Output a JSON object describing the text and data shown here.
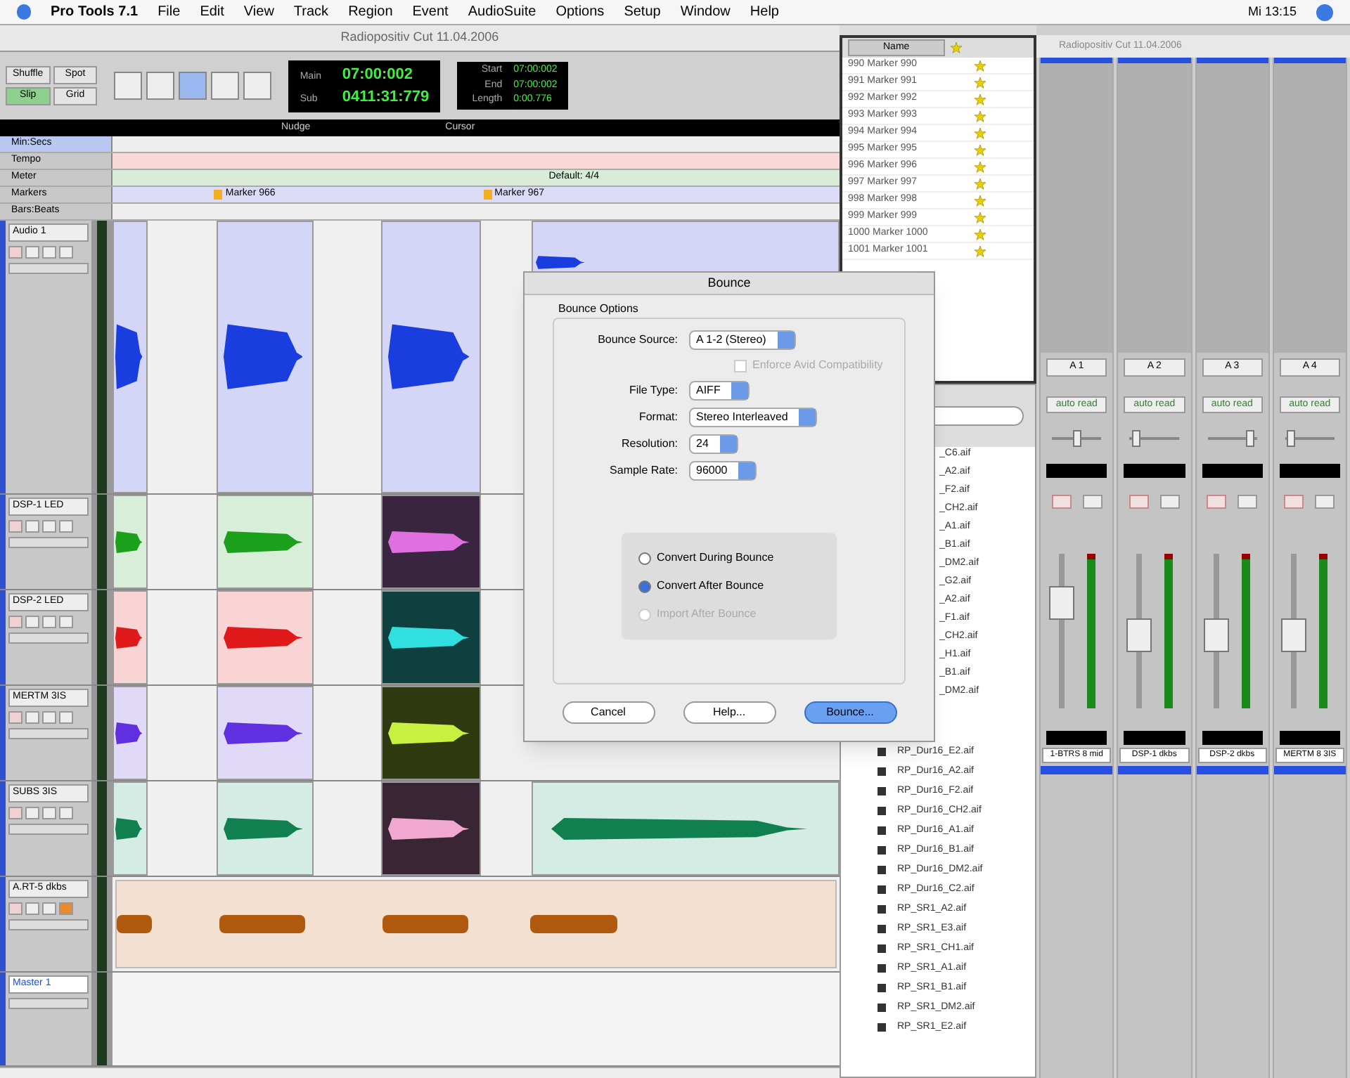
{
  "menu_bar": {
    "app": "Pro Tools 7.1",
    "items": [
      "File",
      "Edit",
      "View",
      "Track",
      "Region",
      "Event",
      "AudioSuite",
      "Options",
      "Setup",
      "Window",
      "Help"
    ],
    "clock": "Mi 13:15"
  },
  "edit_window": {
    "title": "Radiopositiv Cut 11.04.2006",
    "modes": [
      {
        "label": "Shuffle",
        "selected": false
      },
      {
        "label": "Spot",
        "selected": false
      },
      {
        "label": "Slip",
        "selected": true
      },
      {
        "label": "Grid",
        "selected": false
      }
    ],
    "counters": [
      {
        "label": "Main",
        "value": "07:00:002"
      },
      {
        "label": "Sub",
        "value": "0411:31:779"
      }
    ],
    "selection": [
      {
        "label": "Start",
        "value": "07:00:002"
      },
      {
        "label": "End",
        "value": "07:00:002"
      },
      {
        "label": "Length",
        "value": "0:00.776"
      }
    ],
    "strip_labels": [
      "Nudge",
      "Cursor"
    ],
    "rulers": [
      {
        "label": "Min:Secs",
        "kind": "plain"
      },
      {
        "label": "Tempo",
        "kind": "tempo"
      },
      {
        "label": "Meter",
        "kind": "meter",
        "text": "Default: 4/4"
      },
      {
        "label": "Markers",
        "kind": "markers",
        "markers": [
          "Marker 966",
          "Marker 967"
        ]
      },
      {
        "label": "Bars:Beats",
        "kind": "plain"
      }
    ],
    "tracks": [
      {
        "name": "Audio 1",
        "kind": "audio",
        "regions": [
          {
            "color": "#d4d6f8",
            "waveform": {
              "color": "#1a3de0"
            }
          },
          {
            "color": "#d4d6f8",
            "waveform": {
              "color": "#1a3de0"
            }
          },
          {
            "color": "#d4d6f8",
            "waveform": {
              "color": "#1a3de0"
            }
          },
          {
            "color": "#d4d6f8",
            "waveform": {
              "color": "#1a3de0"
            }
          }
        ]
      },
      {
        "name": "DSP-1 LED",
        "kind": "audio",
        "regions": [
          {
            "color": "#d8eed8",
            "waveform": {
              "color": "#1aa01a"
            }
          },
          {
            "color": "#d8eed8",
            "waveform": {
              "color": "#1aa01a"
            }
          },
          {
            "color": "#3a2540",
            "waveform": {
              "color": "#e070e0"
            }
          }
        ]
      },
      {
        "name": "DSP-2 LED",
        "kind": "audio",
        "regions": [
          {
            "color": "#f8d4d4",
            "waveform": {
              "color": "#e01a1a"
            }
          },
          {
            "color": "#f8d4d4",
            "waveform": {
              "color": "#e01a1a"
            }
          },
          {
            "color": "#0f4040",
            "waveform": {
              "color": "#30e0e0"
            }
          }
        ]
      },
      {
        "name": "MERTM 3IS",
        "kind": "audio",
        "regions": [
          {
            "color": "#e0daf8",
            "waveform": {
              "color": "#6030e0"
            }
          },
          {
            "color": "#e0daf8",
            "waveform": {
              "color": "#6030e0"
            }
          },
          {
            "color": "#303a10",
            "waveform": {
              "color": "#c8f040"
            }
          }
        ]
      },
      {
        "name": "SUBS 3IS",
        "kind": "audio",
        "regions": [
          {
            "color": "#d4ece4",
            "waveform": {
              "color": "#108050"
            }
          },
          {
            "color": "#d4ece4",
            "waveform": {
              "color": "#108050"
            }
          },
          {
            "color": "#3a2535",
            "waveform": {
              "color": "#f0a8d0"
            }
          },
          {
            "color": "#d4ece4",
            "waveform": {
              "color": "#108050"
            }
          }
        ]
      },
      {
        "name": "A.RT-5 dkbs",
        "kind": "lane",
        "regions": [
          {
            "color": "#f4e0d0",
            "waveform": {
              "color": "#b05a10"
            }
          }
        ]
      },
      {
        "name": "Master 1",
        "kind": "master"
      }
    ]
  },
  "marker_list": {
    "header": "Name",
    "rows": [
      "990 Marker 990",
      "991 Marker 991",
      "992 Marker 992",
      "993 Marker 993",
      "994 Marker 994",
      "995 Marker 995",
      "996 Marker 996",
      "997 Marker 997",
      "998 Marker 998",
      "999 Marker 999",
      "1000 Marker 1000",
      "1001 Marker 1001"
    ]
  },
  "region_list": {
    "hidden_rows": [
      "_C6.aif",
      "_A2.aif",
      "_F2.aif",
      "_CH2.aif",
      "_A1.aif",
      "_B1.aif",
      "_DM2.aif",
      "_G2.aif",
      "_A2.aif",
      "_F1.aif",
      "_CH2.aif",
      "_H1.aif",
      "_B1.aif",
      "_DM2.aif"
    ],
    "rows": [
      "RP_Dur16_E2.aif",
      "RP_Dur16_A2.aif",
      "RP_Dur16_F2.aif",
      "RP_Dur16_CH2.aif",
      "RP_Dur16_A1.aif",
      "RP_Dur16_B1.aif",
      "RP_Dur16_DM2.aif",
      "RP_Dur16_C2.aif",
      "RP_SR1_A2.aif",
      "RP_SR1_E3.aif",
      "RP_SR1_CH1.aif",
      "RP_SR1_A1.aif",
      "RP_SR1_B1.aif",
      "RP_SR1_DM2.aif",
      "RP_SR1_E2.aif"
    ]
  },
  "mixer": {
    "title": "Radiopositiv Cut 11.04.2006",
    "strips": [
      {
        "io": "A 1",
        "auto": "auto read",
        "pan": {
          "level": 0.5
        },
        "level": 0.72,
        "name": "1-BTRS 8 mid"
      },
      {
        "io": "A 2",
        "auto": "auto read",
        "pan": {
          "level": 0.05
        },
        "level": 0.45,
        "name": "DSP-1 dkbs"
      },
      {
        "io": "A 3",
        "auto": "auto read",
        "pan": {
          "level": 0.95
        },
        "level": 0.45,
        "name": "DSP-2 dkbs"
      },
      {
        "io": "A 4",
        "auto": "auto read",
        "pan": {
          "level": 0.05
        },
        "level": 0.45,
        "name": "MERTM 8 3IS"
      }
    ]
  },
  "dialog": {
    "title": "Bounce",
    "group": "Bounce Options",
    "fields": [
      {
        "label": "Bounce Source:",
        "value": "A 1-2 (Stereo)"
      },
      {
        "label": "File Type:",
        "value": "AIFF"
      },
      {
        "label": "Format:",
        "value": "Stereo Interleaved"
      },
      {
        "label": "Resolution:",
        "value": "24"
      },
      {
        "label": "Sample Rate:",
        "value": "96000"
      }
    ],
    "checkbox": {
      "label": "Enforce Avid Compatibility",
      "checked": false,
      "disabled": true
    },
    "options": [
      {
        "label": "Convert During Bounce",
        "selected": false,
        "disabled": false
      },
      {
        "label": "Convert After Bounce",
        "selected": true,
        "disabled": false
      },
      {
        "label": "Import After Bounce",
        "selected": false,
        "disabled": true
      }
    ],
    "buttons": [
      {
        "label": "Cancel",
        "default": false
      },
      {
        "label": "Help...",
        "default": false
      },
      {
        "label": "Bounce...",
        "default": true
      }
    ]
  }
}
